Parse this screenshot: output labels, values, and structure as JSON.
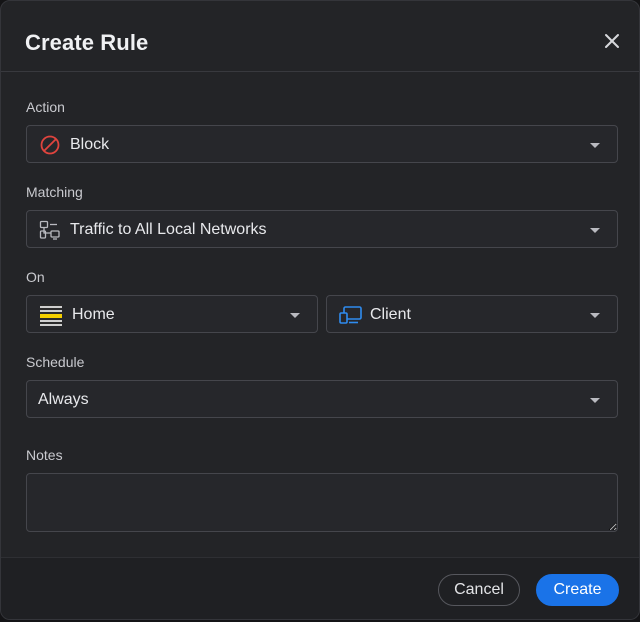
{
  "dialog": {
    "title": "Create Rule",
    "close_icon": "close-icon"
  },
  "action": {
    "label": "Action",
    "value": "Block",
    "icon": "block-icon",
    "icon_color": "#e0443e"
  },
  "matching": {
    "label": "Matching",
    "value": "Traffic to All Local Networks",
    "icon": "local-networks-icon"
  },
  "on": {
    "label": "On",
    "network": {
      "value": "Home",
      "icon": "network-flag-icon",
      "icon_color": "#f5d000"
    },
    "target": {
      "value": "Client",
      "icon": "client-devices-icon",
      "icon_color": "#2f8cf0"
    }
  },
  "schedule": {
    "label": "Schedule",
    "value": "Always"
  },
  "notes": {
    "label": "Notes",
    "value": ""
  },
  "footer": {
    "cancel_label": "Cancel",
    "create_label": "Create"
  },
  "colors": {
    "accent": "#1a73e8",
    "background": "#232427",
    "border": "#45464c"
  }
}
